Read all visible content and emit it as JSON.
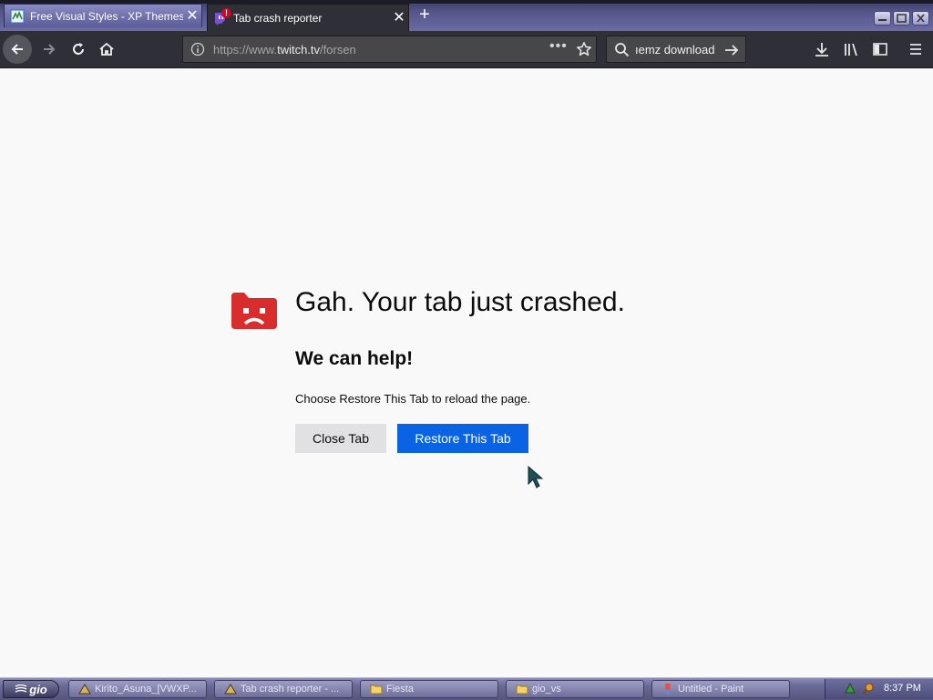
{
  "tabs": [
    {
      "title": "Free Visual Styles - XP Themes - Fr",
      "favicon": "xp-themes-favicon",
      "close": "✕",
      "active": false
    },
    {
      "title": "Tab crash reporter",
      "favicon": "twitch-crash-favicon",
      "badge": "!",
      "close": "✕",
      "active": true
    }
  ],
  "newtab_label": "+",
  "window_controls": [
    "minimize-icon",
    "maximize-icon",
    "close-icon"
  ],
  "navbar": {
    "url_prefix": "https://www.",
    "url_domain": "twitch.tv",
    "url_path": "/forsen",
    "page_actions": "•••",
    "search_text": "ıemz download"
  },
  "crash": {
    "title": "Gah. Your tab just crashed.",
    "subtitle": "We can help!",
    "description": "Choose Restore This Tab to reload the page.",
    "close_label": "Close Tab",
    "restore_label": "Restore This Tab"
  },
  "taskbar": {
    "start_label": "gio",
    "tasks": [
      {
        "label": "Kirito_Asuna_[VWXP...",
        "icon": "kirito-icon"
      },
      {
        "label": "Tab crash reporter - ...",
        "icon": "firefox-icon"
      },
      {
        "label": "Fiesta",
        "icon": "folder-icon"
      },
      {
        "label": "gio_vs",
        "icon": "folder-icon"
      },
      {
        "label": "Untitled - Paint",
        "icon": "paint-icon"
      }
    ],
    "clock": "8:37 PM"
  },
  "colors": {
    "accent": "#0a63e3",
    "crash_icon": "#d92d2d",
    "toolbar": "#2f2f37"
  }
}
